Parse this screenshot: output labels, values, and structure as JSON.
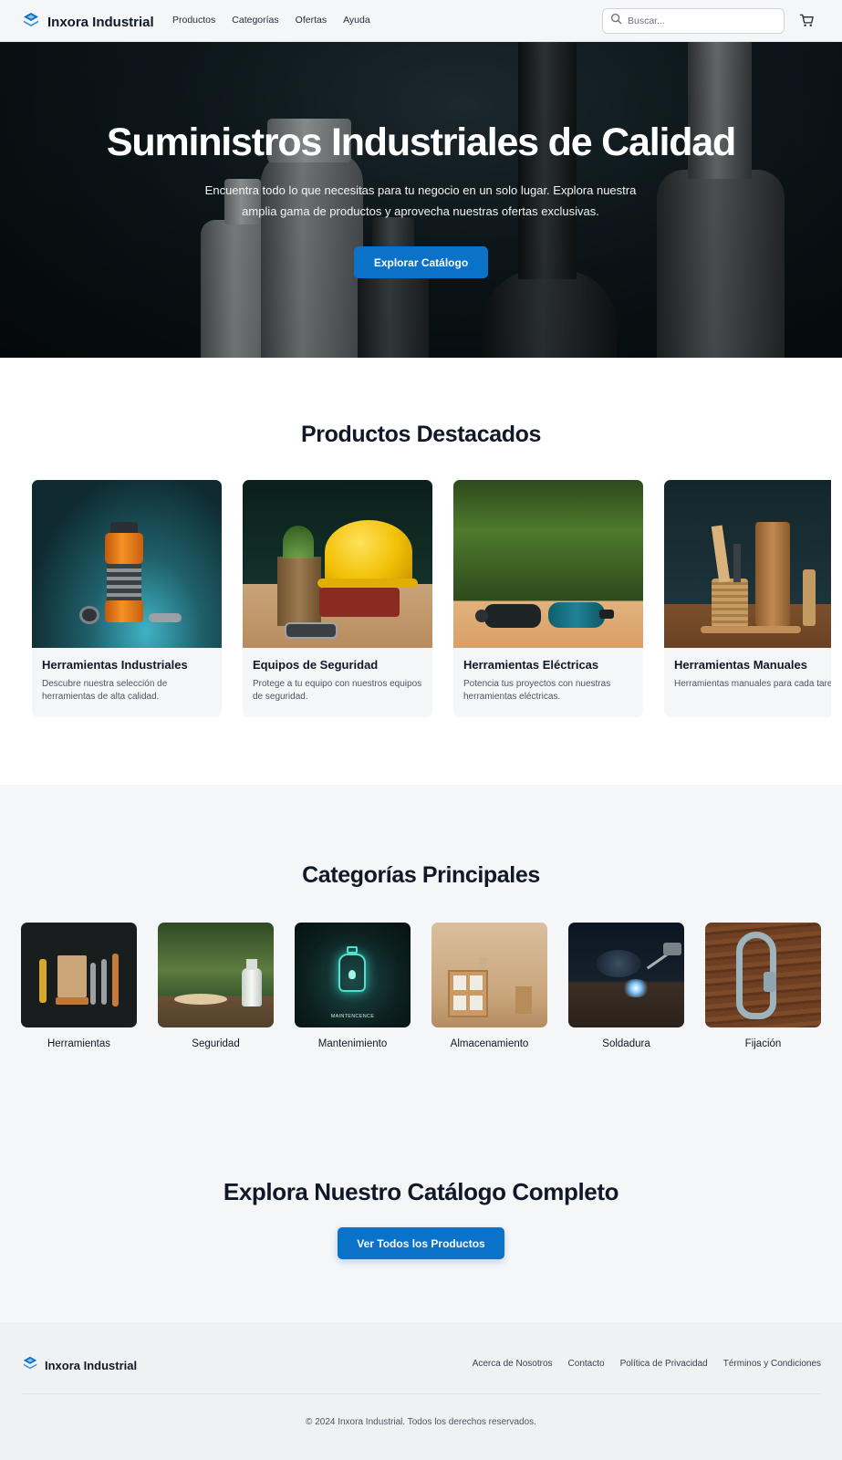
{
  "nav": {
    "brand": "Inxora Industrial",
    "links": [
      "Productos",
      "Categorías",
      "Ofertas",
      "Ayuda"
    ],
    "search_placeholder": "Buscar...",
    "icons": {
      "logo": "layers-logo-icon",
      "search": "search-icon",
      "cart": "cart-icon"
    }
  },
  "hero": {
    "title": "Suministros Industriales de Calidad",
    "subtitle": "Encuentra todo lo que necesitas para tu negocio en un solo lugar. Explora nuestra amplia gama de productos y aprovecha nuestras ofertas exclusivas.",
    "button": "Explorar Catálogo"
  },
  "featured": {
    "title": "Productos Destacados",
    "cards": [
      {
        "title": "Herramientas Industriales",
        "desc": "Descubre nuestra selección de herramientas de alta calidad."
      },
      {
        "title": "Equipos de Seguridad",
        "desc": "Protege a tu equipo con nuestros equipos de seguridad."
      },
      {
        "title": "Herramientas Eléctricas",
        "desc": "Potencia tus proyectos con nuestras herramientas eléctricas."
      },
      {
        "title": "Herramientas Manuales",
        "desc": "Herramientas manuales para cada tarea."
      }
    ]
  },
  "categories": {
    "title": "Categorías Principales",
    "items": [
      "Herramientas",
      "Seguridad",
      "Mantenimiento",
      "Almacenamiento",
      "Soldadura",
      "Fijación"
    ],
    "maintenance_caption": "MAINTENCENCE"
  },
  "cta": {
    "title": "Explora Nuestro Catálogo Completo",
    "button": "Ver Todos los Productos"
  },
  "footer": {
    "brand": "Inxora Industrial",
    "links": [
      "Acerca de Nosotros",
      "Contacto",
      "Política de Privacidad",
      "Términos y Condiciones"
    ],
    "copyright": "© 2024 Inxora Industrial. Todos los derechos reservados."
  },
  "colors": {
    "accent": "#0b72c9",
    "background": "#f5f6f8",
    "text": "#111827"
  }
}
